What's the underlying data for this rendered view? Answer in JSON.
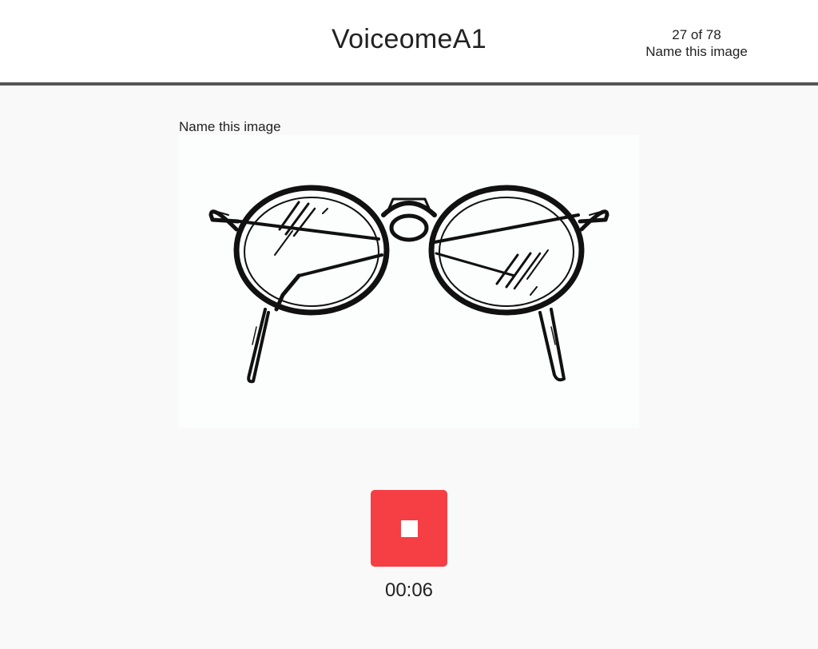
{
  "header": {
    "app_title": "VoiceomeA1",
    "progress": {
      "counter": "27 of 78",
      "task_name": "Name this image"
    }
  },
  "main": {
    "prompt_label": "Name this image",
    "image": {
      "subject": "eyeglasses",
      "style": "black-and-white line drawing"
    },
    "record_button": {
      "state": "recording",
      "icon": "stop-icon",
      "color": "#f53f44"
    },
    "timer": "00:06"
  }
}
